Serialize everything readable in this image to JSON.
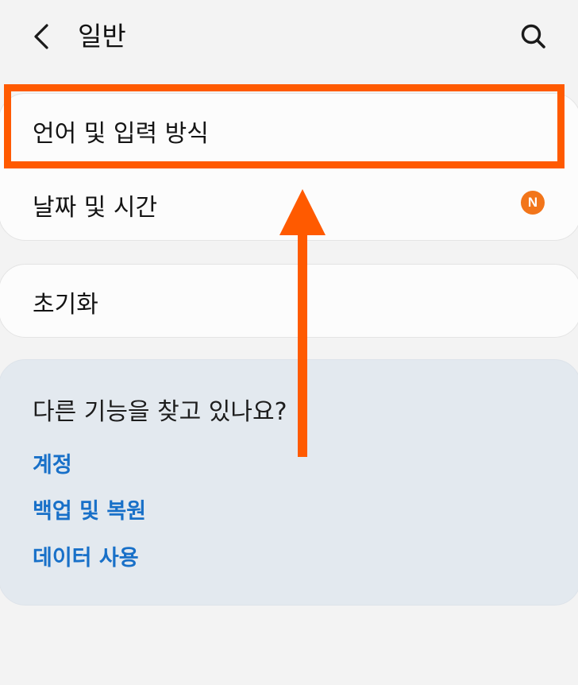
{
  "header": {
    "title": "일반",
    "back_icon": "chevron-left-icon",
    "search_icon": "search-icon"
  },
  "settings": {
    "items": [
      {
        "label": "언어 및 입력 방식"
      },
      {
        "label": "날짜 및 시간",
        "badge": "N"
      }
    ],
    "reset": {
      "label": "초기화"
    }
  },
  "suggestions": {
    "title": "다른 기능을 찾고 있나요?",
    "links": [
      {
        "label": "계정"
      },
      {
        "label": "백업 및 복원"
      },
      {
        "label": "데이터 사용"
      }
    ]
  },
  "colors": {
    "accent_orange": "#ff5a00",
    "badge_orange": "#f2751a",
    "link_blue": "#1870c8",
    "background": "#f3f3f3",
    "panel": "#e3e9ef"
  }
}
